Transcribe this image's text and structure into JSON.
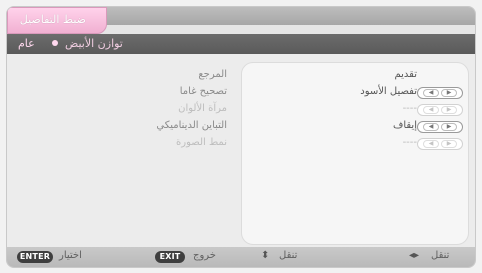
{
  "header": {
    "title": "ضبط التفاصيل",
    "tabs": [
      {
        "label": "عام",
        "active": true
      },
      {
        "label": "توازن الأبيض",
        "active": false
      }
    ]
  },
  "rows": [
    {
      "label": "المرجع",
      "value": "تقديم",
      "enabled": true,
      "has_arrows": false
    },
    {
      "label": "تصحيح غاما",
      "value": "تفصيل الأسود",
      "enabled": true,
      "has_arrows": true
    },
    {
      "label": "مرآة الألوان",
      "value": "----",
      "enabled": false,
      "has_arrows": true
    },
    {
      "label": "التباين الديناميكي",
      "value": "إيقاف",
      "enabled": true,
      "has_arrows": true
    },
    {
      "label": "نمط الصورة",
      "value": "----",
      "enabled": false,
      "has_arrows": true
    }
  ],
  "footer": {
    "select": {
      "key": "ENTER",
      "label": "اختيار"
    },
    "exit": {
      "key": "EXIT",
      "label": "خروج"
    },
    "move_vertical": {
      "icon": "⬍",
      "label": "تنقل"
    },
    "move_horizontal": {
      "icon": "◂▸",
      "label": "تنقل"
    }
  },
  "colors": {
    "accent": "#f1b0d2",
    "tab_text": "#ffd8ee",
    "band": "#5f5f5f"
  },
  "icons": {
    "left_arrow": "◀",
    "right_arrow": "▶"
  }
}
